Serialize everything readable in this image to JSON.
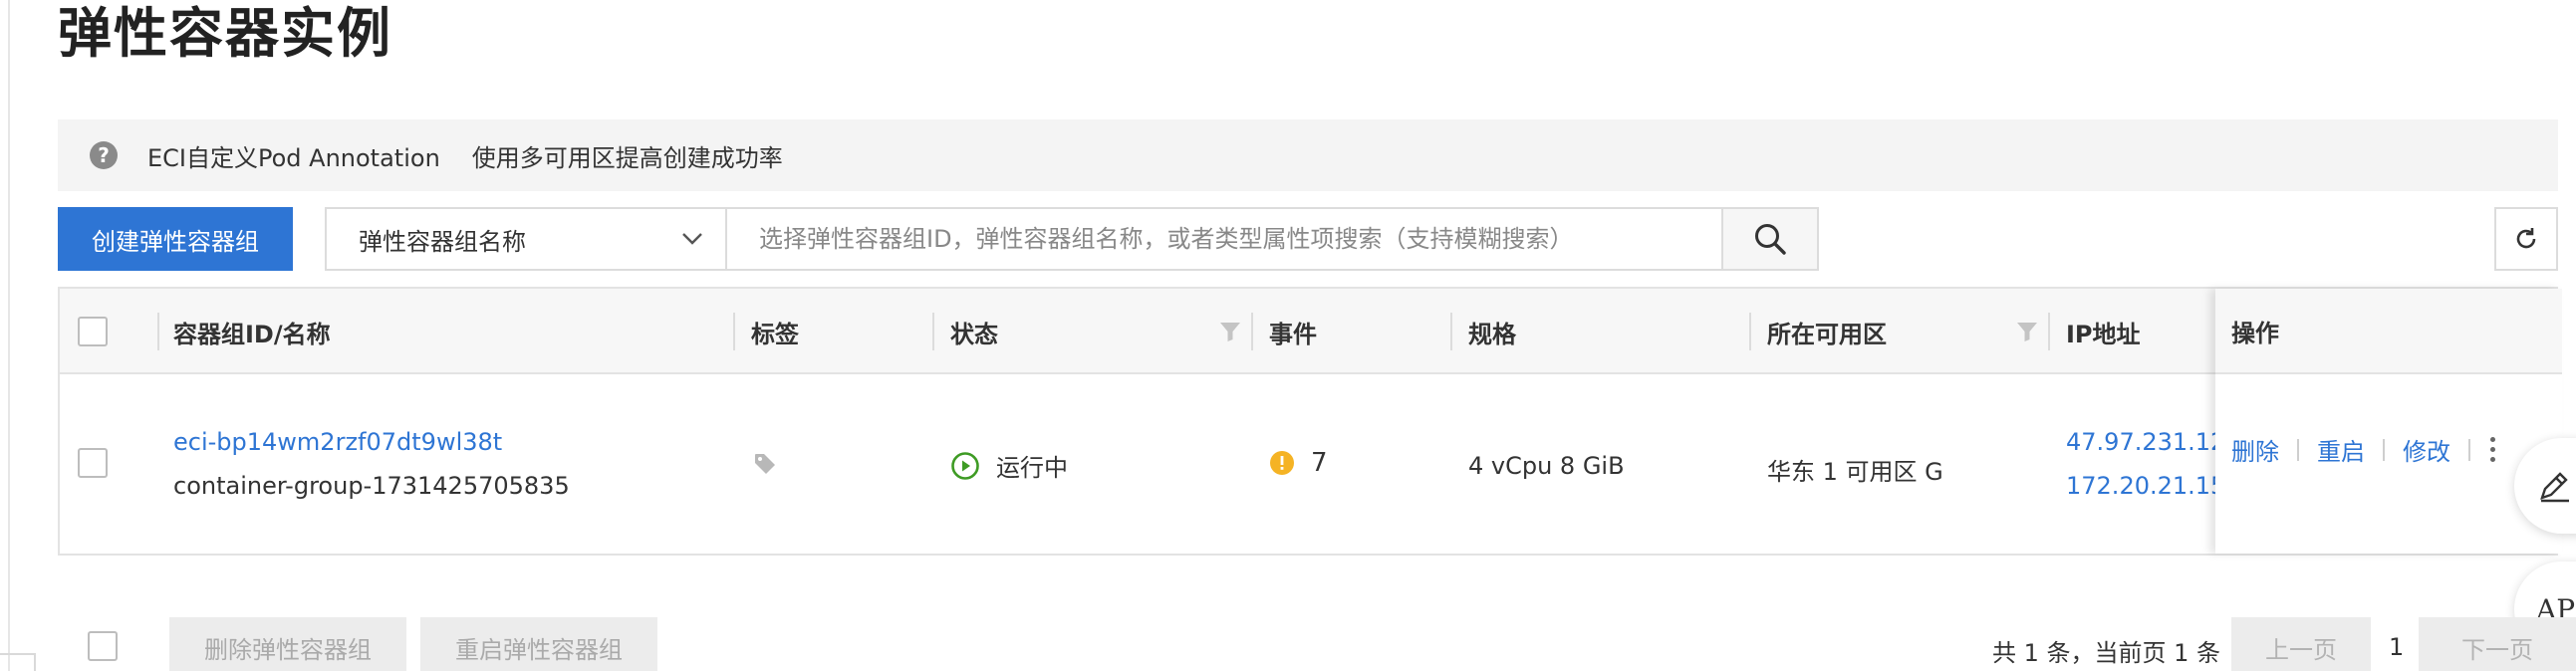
{
  "page": {
    "title": "弹性容器实例"
  },
  "notice": {
    "links": [
      "ECI自定义Pod Annotation",
      "使用多可用区提高创建成功率"
    ]
  },
  "toolbar": {
    "create_label": "创建弹性容器组",
    "search_field": "弹性容器组名称",
    "search_placeholder": "选择弹性容器组ID，弹性容器组名称，或者类型属性项搜索（支持模糊搜索）"
  },
  "table": {
    "columns": {
      "id_name": "容器组ID/名称",
      "tags": "标签",
      "status": "状态",
      "events": "事件",
      "spec": "规格",
      "zone": "所在可用区",
      "ip": "IP地址",
      "ops": "操作"
    },
    "rows": [
      {
        "id": "eci-bp14wm2rzf07dt9wl38t",
        "name": "container-group-1731425705835",
        "status": "运行中",
        "events": "7",
        "spec": "4 vCpu 8 GiB",
        "zone": "华东 1 可用区 G",
        "ip_public": "47.97.231.12",
        "ip_private": "172.20.21.15"
      }
    ],
    "actions": {
      "delete": "删除",
      "restart": "重启",
      "modify": "修改"
    }
  },
  "footer": {
    "bulk_delete": "删除弹性容器组",
    "bulk_restart": "重启弹性容器组",
    "pager_info": "共 1 条，当前页 1 条",
    "prev": "上一页",
    "current_page": "1",
    "next": "下一页"
  },
  "float": {
    "api_label": "API"
  },
  "colors": {
    "primary": "#2e75d4",
    "running": "#3e9b24",
    "warning": "#f5b324"
  }
}
